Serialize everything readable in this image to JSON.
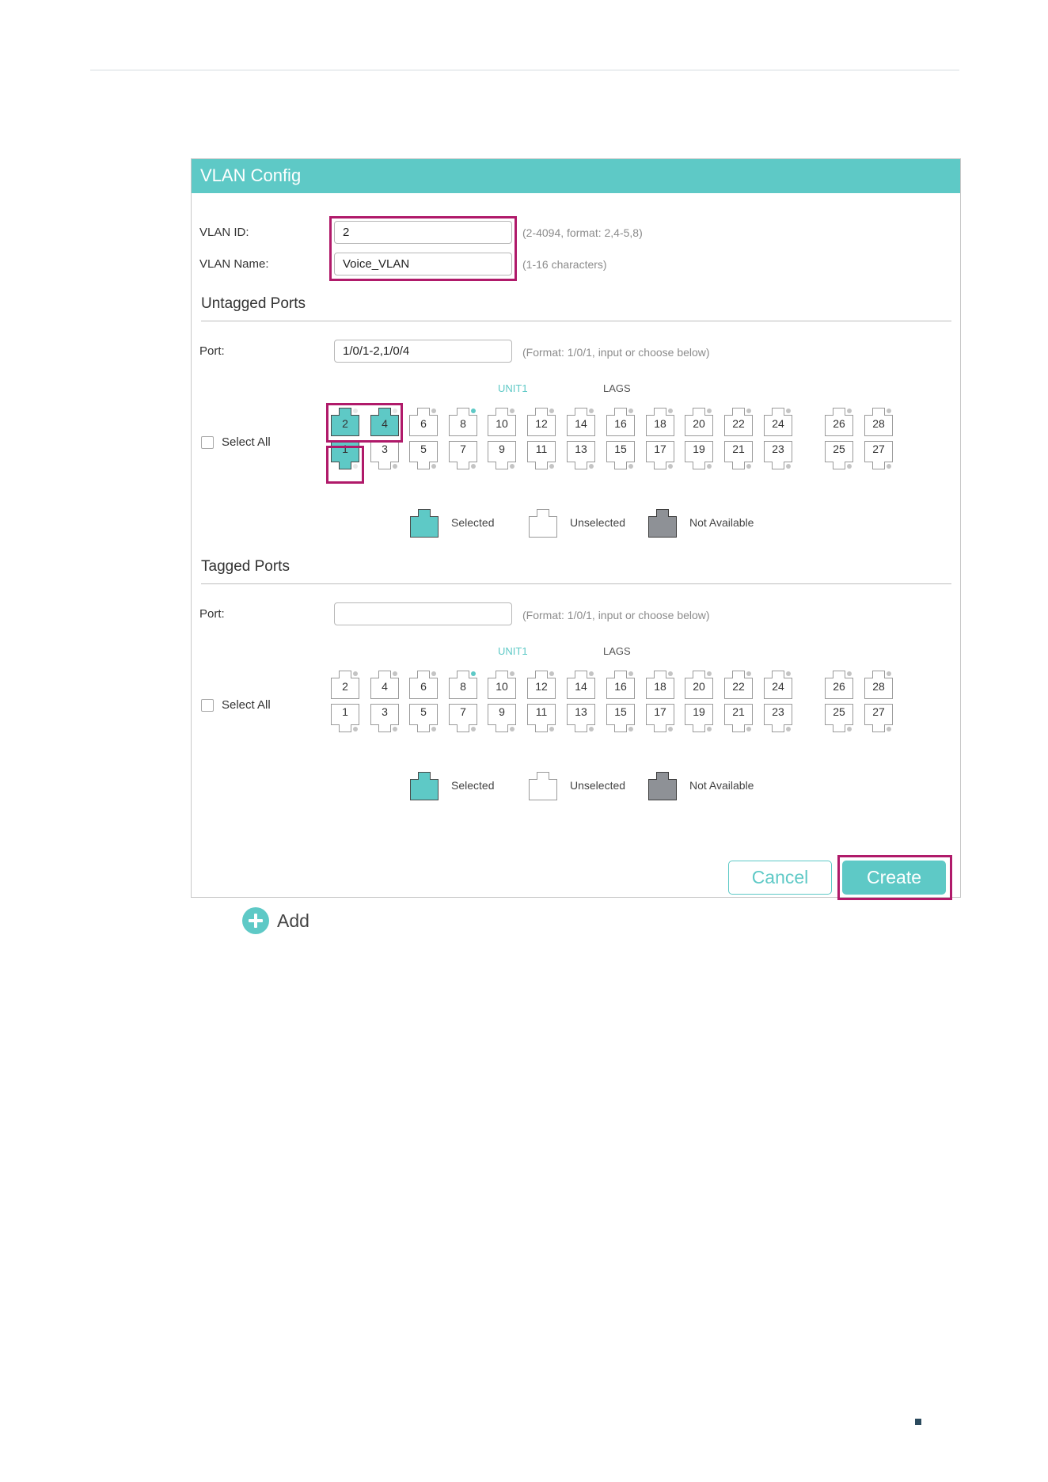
{
  "panel": {
    "title": "VLAN Config"
  },
  "vlan_id": {
    "label": "VLAN ID:",
    "value": "2",
    "hint": "(2-4094, format: 2,4-5,8)"
  },
  "vlan_name": {
    "label": "VLAN Name:",
    "value": "Voice_VLAN",
    "hint": "(1-16 characters)"
  },
  "untagged": {
    "title": "Untagged Ports",
    "port_label": "Port:",
    "port_value": "1/0/1-2,1/0/4",
    "port_hint": "(Format: 1/0/1, input or choose below)",
    "unit_label": "UNIT1",
    "lags_label": "LAGS",
    "select_all": "Select All",
    "selected_ports": [
      "1",
      "2",
      "4"
    ]
  },
  "tagged": {
    "title": "Tagged Ports",
    "port_label": "Port:",
    "port_value": "",
    "port_hint": "(Format: 1/0/1, input or choose below)",
    "unit_label": "UNIT1",
    "lags_label": "LAGS",
    "select_all": "Select All",
    "selected_ports": []
  },
  "ports": {
    "top_row": [
      "2",
      "4",
      "6",
      "8",
      "10",
      "12",
      "14",
      "16",
      "18",
      "20",
      "22",
      "24",
      "26",
      "28"
    ],
    "bottom_row": [
      "1",
      "3",
      "5",
      "7",
      "9",
      "11",
      "13",
      "15",
      "17",
      "19",
      "21",
      "23",
      "25",
      "27"
    ],
    "link_up_port": "8"
  },
  "legend": {
    "selected": "Selected",
    "unselected": "Unselected",
    "not_available": "Not Available"
  },
  "colors": {
    "accent": "#5ec9c6",
    "highlight": "#b01a6a",
    "not_available": "#8e9196"
  },
  "buttons": {
    "cancel": "Cancel",
    "create": "Create"
  },
  "add": {
    "label": "Add",
    "icon": "plus-circle-icon"
  }
}
